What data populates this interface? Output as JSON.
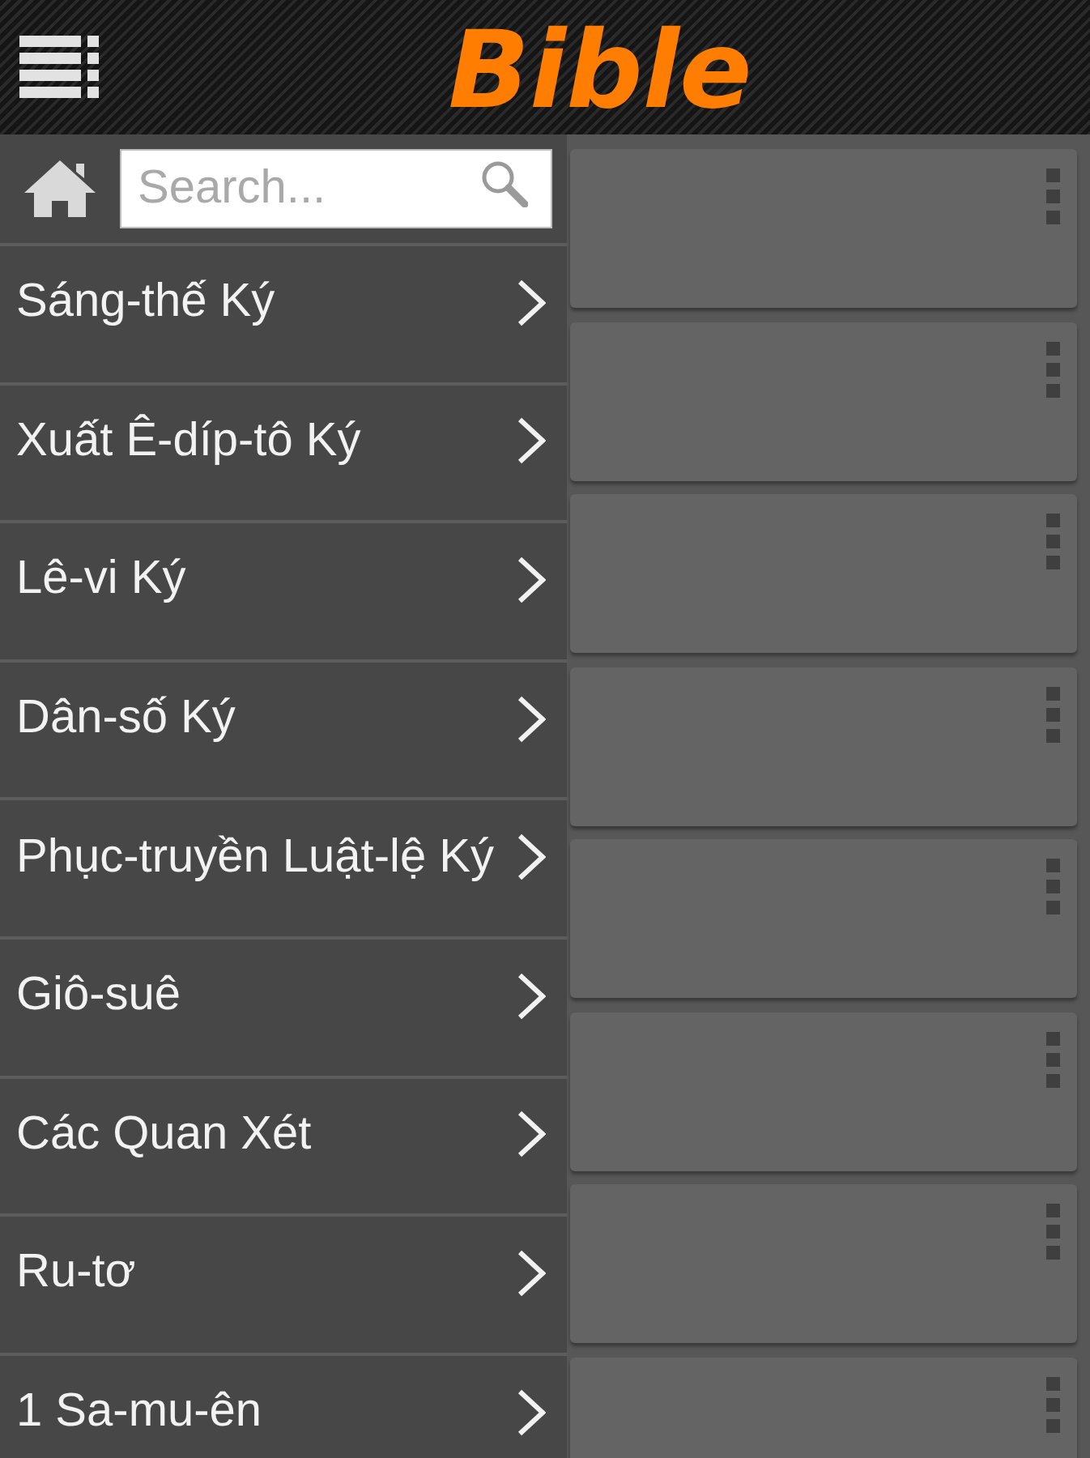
{
  "header": {
    "title": "Bible"
  },
  "drawer": {
    "search": {
      "placeholder": "Search..."
    },
    "books": [
      {
        "label": "Sáng-thế Ký"
      },
      {
        "label": "Xuất Ê-díp-tô Ký"
      },
      {
        "label": "Lê-vi Ký"
      },
      {
        "label": "Dân-số Ký"
      },
      {
        "label": "Phục-truyền Luật-lệ Ký"
      },
      {
        "label": "Giô-suê"
      },
      {
        "label": "Các Quan Xét"
      },
      {
        "label": "Ru-tơ"
      },
      {
        "label": "1 Sa-mu-ên"
      }
    ]
  },
  "cards": [
    {
      "kind": "blank"
    },
    {
      "kind": "blank"
    },
    {
      "kind": "blank"
    },
    {
      "kind": "blank"
    },
    {
      "kind": "blank"
    },
    {
      "kind": "blank"
    },
    {
      "kind": "blank"
    },
    {
      "kind": "blank"
    }
  ]
}
